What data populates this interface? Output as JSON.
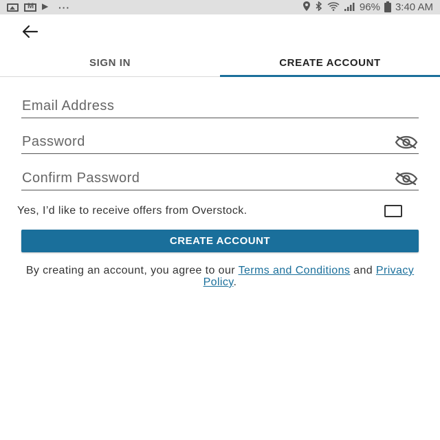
{
  "status_bar": {
    "left_icons": [
      "image-icon",
      "mail-icon",
      "flag-icon",
      "more-icon"
    ],
    "more": "···",
    "right_icons": [
      "location-icon",
      "bluetooth-icon",
      "wifi-icon",
      "signal-icon",
      "battery-icon"
    ],
    "battery": "96%",
    "time": "3:40 AM"
  },
  "header": {
    "back_icon": "arrow-left-icon"
  },
  "tabs": [
    {
      "label": "SIGN IN",
      "active": false
    },
    {
      "label": "CREATE ACCOUNT",
      "active": true
    }
  ],
  "form": {
    "email": {
      "placeholder": "Email Address",
      "value": ""
    },
    "password": {
      "placeholder": "Password",
      "value": "",
      "toggle_icon": "eye-off-icon"
    },
    "confirm_password": {
      "placeholder": "Confirm Password",
      "value": "",
      "toggle_icon": "eye-off-icon"
    },
    "offers": {
      "label": "Yes, I’d like to receive offers from Overstock.",
      "checked": false
    },
    "submit_label": "CREATE ACCOUNT"
  },
  "legal": {
    "prefix": "By creating an account, you agree to our ",
    "terms_link": "Terms and Conditions",
    "middle": " and ",
    "privacy_link": "Privacy Policy",
    "suffix": "."
  },
  "colors": {
    "accent": "#1a6f9b",
    "status_bar_bg": "#e0e0e0",
    "text": "#333333"
  }
}
